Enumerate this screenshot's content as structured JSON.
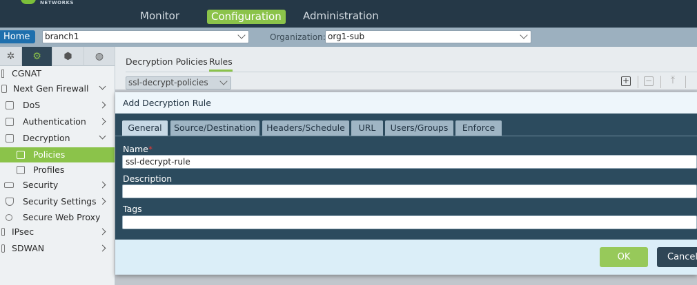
{
  "header": {
    "logo_text": "NETWORKS",
    "nav": {
      "monitor": "Monitor",
      "configuration": "Configuration",
      "administration": "Administration"
    }
  },
  "context_bar": {
    "home_label": "Home",
    "branch_value": "branch1",
    "org_label": "Organization:",
    "org_value": "org1-sub"
  },
  "sidebar": {
    "items": [
      {
        "label": "CGNAT"
      },
      {
        "label": "Next Gen Firewall"
      },
      {
        "label": "DoS"
      },
      {
        "label": "Authentication"
      },
      {
        "label": "Decryption"
      },
      {
        "label": "Policies"
      },
      {
        "label": "Profiles"
      },
      {
        "label": "Security"
      },
      {
        "label": "Security Settings"
      },
      {
        "label": "Secure Web Proxy"
      },
      {
        "label": "IPsec"
      },
      {
        "label": "SDWAN"
      }
    ]
  },
  "main": {
    "tabs": {
      "decryption_policies": "Decryption Policies",
      "rules": "Rules"
    },
    "policy_select_value": "ssl-decrypt-policies",
    "toolbar": {
      "add": "+",
      "remove": "−"
    }
  },
  "modal": {
    "title": "Add Decryption Rule",
    "tabs": [
      "General",
      "Source/Destination",
      "Headers/Schedule",
      "URL",
      "Users/Groups",
      "Enforce"
    ],
    "fields": {
      "name_label": "Name",
      "name_required": "*",
      "name_value": "ssl-decrypt-rule",
      "description_label": "Description",
      "description_value": "",
      "tags_label": "Tags",
      "tags_value": ""
    },
    "ok_label": "OK",
    "cancel_label": "Cancel"
  },
  "colors": {
    "accent_green": "#8bc34a",
    "header_dark": "#253847",
    "modal_body": "#2c4b5e",
    "home_blue": "#1e6fad"
  }
}
